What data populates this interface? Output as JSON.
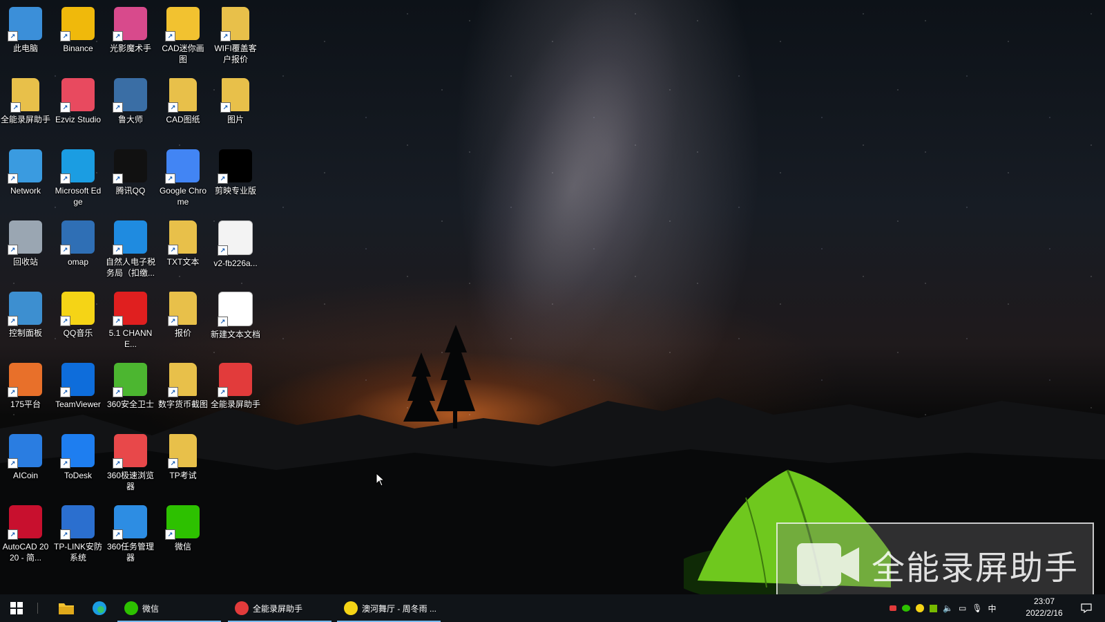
{
  "desktop_icons": [
    {
      "label": "此电脑",
      "icon": "computer-icon",
      "color": "#3b8fd9"
    },
    {
      "label": "全能录屏助手",
      "icon": "folder-icon",
      "color": "#e8c04a"
    },
    {
      "label": "Network",
      "icon": "network-icon",
      "color": "#3a9be0"
    },
    {
      "label": "回收站",
      "icon": "recycle-bin-icon",
      "color": "#9aa6b2"
    },
    {
      "label": "控制面板",
      "icon": "control-panel-icon",
      "color": "#3d8fd0"
    },
    {
      "label": "175平台",
      "icon": "platform-175-icon",
      "color": "#e8702a"
    },
    {
      "label": "AICoin",
      "icon": "aicoin-icon",
      "color": "#2a7de1"
    },
    {
      "label": "AutoCAD 2020 - 简...",
      "icon": "autocad-icon",
      "color": "#c8102e"
    },
    {
      "label": "Binance",
      "icon": "binance-icon",
      "color": "#f0b90b"
    },
    {
      "label": "Ezviz Studio",
      "icon": "ezviz-icon",
      "color": "#e84a5f"
    },
    {
      "label": "Microsoft Edge",
      "icon": "edge-icon",
      "color": "#1b9de2"
    },
    {
      "label": "omap",
      "icon": "omap-icon",
      "color": "#2f6fb5"
    },
    {
      "label": "QQ音乐",
      "icon": "qq-music-icon",
      "color": "#f5d416"
    },
    {
      "label": "TeamViewer",
      "icon": "teamviewer-icon",
      "color": "#0e6ddb"
    },
    {
      "label": "ToDesk",
      "icon": "todesk-icon",
      "color": "#1e7ef0"
    },
    {
      "label": "TP-LINK安防系统",
      "icon": "tplink-security-icon",
      "color": "#2b6fcf"
    },
    {
      "label": "光影魔术手",
      "icon": "neo-imaging-icon",
      "color": "#d84a8c"
    },
    {
      "label": "鲁大师",
      "icon": "ludashi-icon",
      "color": "#3a6ea5"
    },
    {
      "label": "腾讯QQ",
      "icon": "qq-icon",
      "color": "#111111"
    },
    {
      "label": "自然人电子税务局（扣缴...",
      "icon": "tax-bureau-icon",
      "color": "#1f8be0"
    },
    {
      "label": "5.1 CHANNE...",
      "icon": "channel-51-icon",
      "color": "#e01f1f"
    },
    {
      "label": "360安全卫士",
      "icon": "360-security-icon",
      "color": "#4cb630"
    },
    {
      "label": "360极速浏览器",
      "icon": "360-browser-icon",
      "color": "#e8484a"
    },
    {
      "label": "360任务管理器",
      "icon": "360-task-manager-icon",
      "color": "#2d8de3"
    },
    {
      "label": "CAD迷你画图",
      "icon": "cad-mini-draw-icon",
      "color": "#f2c230"
    },
    {
      "label": "CAD图纸",
      "icon": "folder-icon",
      "color": "#e8c04a"
    },
    {
      "label": "Google Chrome",
      "icon": "chrome-icon",
      "color": "#4285f4"
    },
    {
      "label": "TXT文本",
      "icon": "folder-icon",
      "color": "#e8c04a"
    },
    {
      "label": "报价",
      "icon": "folder-icon",
      "color": "#e8c04a"
    },
    {
      "label": "数字货币截图",
      "icon": "folder-icon",
      "color": "#e8c04a"
    },
    {
      "label": "TP考试",
      "icon": "folder-icon",
      "color": "#e8c04a"
    },
    {
      "label": "微信",
      "icon": "wechat-icon",
      "color": "#2dc100"
    },
    {
      "label": "WIFI覆盖客户报价",
      "icon": "folder-icon",
      "color": "#e8c04a"
    },
    {
      "label": "图片",
      "icon": "folder-icon",
      "color": "#e8c04a"
    },
    {
      "label": "剪映专业版",
      "icon": "capcut-icon",
      "color": "#000000"
    },
    {
      "label": "v2-fb226a...",
      "icon": "image-file-icon",
      "color": "#f3f3f3"
    },
    {
      "label": "新建文本文档",
      "icon": "text-document-icon",
      "color": "#ffffff"
    },
    {
      "label": "全能录屏助手",
      "icon": "screen-recorder-icon",
      "color": "#e23b3b"
    }
  ],
  "watermark": {
    "text": "全能录屏助手"
  },
  "taskbar": {
    "apps": [
      {
        "label": "微信",
        "icon": "wechat-icon",
        "color": "#2dc100"
      },
      {
        "label": "全能录屏助手",
        "icon": "screen-recorder-icon",
        "color": "#e23b3b"
      },
      {
        "label": "澳河舞厅 - 周冬雨 ...",
        "icon": "qq-music-icon",
        "color": "#f5d416"
      }
    ],
    "ime": "中",
    "time": "23:07",
    "date": "2022/2/16"
  }
}
